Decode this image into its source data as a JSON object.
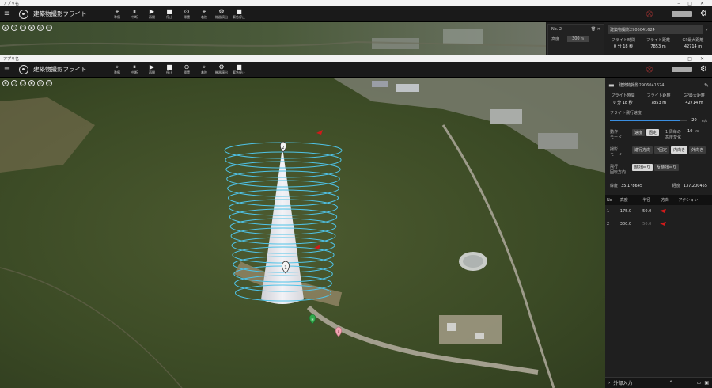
{
  "top_window": {
    "title": "アプリ名",
    "app_title": "建築物撮影フライト",
    "toolbar": [
      {
        "label": "準備",
        "glyph": "⌖",
        "icon": "drone-icon"
      },
      {
        "label": "中断",
        "glyph": "⏸",
        "icon": "pause-icon"
      },
      {
        "label": "再開",
        "glyph": "▶",
        "icon": "play-icon"
      },
      {
        "label": "停止",
        "glyph": "■",
        "icon": "stop-icon"
      },
      {
        "label": "帰還",
        "glyph": "⊙",
        "icon": "return-icon"
      },
      {
        "label": "着陸",
        "glyph": "⌖",
        "icon": "landing-icon"
      },
      {
        "label": "機器演出",
        "glyph": "⚙",
        "icon": "device-icon"
      },
      {
        "label": "緊急停止",
        "glyph": "■",
        "icon": "emergency-stop-icon"
      }
    ],
    "popup": {
      "no": "No. 2",
      "height_label": "高度",
      "height_value": "300",
      "height_unit": "m"
    },
    "panel": {
      "file_name": "建築物撮影2906041624",
      "headers": [
        "フライト時間",
        "フライト距離",
        "GP最大距離"
      ],
      "values": [
        "0 分 18 秒",
        "7853 m",
        "42714 m"
      ]
    }
  },
  "main_window": {
    "title": "アプリ名",
    "app_title": "建築物撮影フライト",
    "toolbar": [
      {
        "label": "準備",
        "glyph": "⌖",
        "icon": "drone-icon"
      },
      {
        "label": "中断",
        "glyph": "⏸",
        "icon": "pause-icon"
      },
      {
        "label": "再開",
        "glyph": "▶",
        "icon": "play-icon"
      },
      {
        "label": "停止",
        "glyph": "■",
        "icon": "stop-icon"
      },
      {
        "label": "帰還",
        "glyph": "⊙",
        "icon": "return-icon"
      },
      {
        "label": "着陸",
        "glyph": "⌖",
        "icon": "landing-icon"
      },
      {
        "label": "機器演出",
        "glyph": "⚙",
        "icon": "device-icon"
      },
      {
        "label": "緊急停止",
        "glyph": "■",
        "icon": "emergency-stop-icon"
      }
    ],
    "map": {
      "markers": [
        "2",
        "1"
      ],
      "home_marker": "H",
      "pin_marker": "P"
    },
    "panel": {
      "file_name": "建築物撮影2906041624",
      "headers": [
        "フライト時間",
        "フライト距離",
        "GP最大距離"
      ],
      "values": [
        "0 分 18 秒",
        "7853 m",
        "42714 m"
      ],
      "speed_label": "フライト飛行速度",
      "speed_value": "20",
      "speed_unit": "m/s",
      "speed_level": 0.9,
      "motion_mode_label": "動作\nモード",
      "motion_mode_options": [
        "速度",
        "固定"
      ],
      "motion_mode_selected": 1,
      "per_turn_label": "1 周毎の\n高度変化",
      "per_turn_value": "10",
      "per_turn_unit": "m",
      "camera_mode_label": "撮影\nモード",
      "camera_mode_options": [
        "進行方向",
        "P固定",
        "内向き",
        "外向き"
      ],
      "camera_mode_selected": 2,
      "rotation_label": "飛行\n回転方向",
      "rotation_options": [
        "時計回り",
        "反時計回り"
      ],
      "rotation_selected": 0,
      "lat_label": "緯度",
      "lat_value": "35.178645",
      "lon_label": "経度",
      "lon_value": "137.200455",
      "table_headers": [
        "No",
        "高度",
        "半径",
        "方向",
        "アクション"
      ],
      "rows": [
        {
          "no": "1",
          "alt": "175.0",
          "radius": "50.0"
        },
        {
          "no": "2",
          "alt": "300.0",
          "radius": "50.0"
        }
      ]
    },
    "bottom_label": "外部入力"
  },
  "colors": {
    "ring": "#4fc3e8",
    "accent_red": "#d11a1a",
    "panel_bg": "#1f1f1f"
  }
}
